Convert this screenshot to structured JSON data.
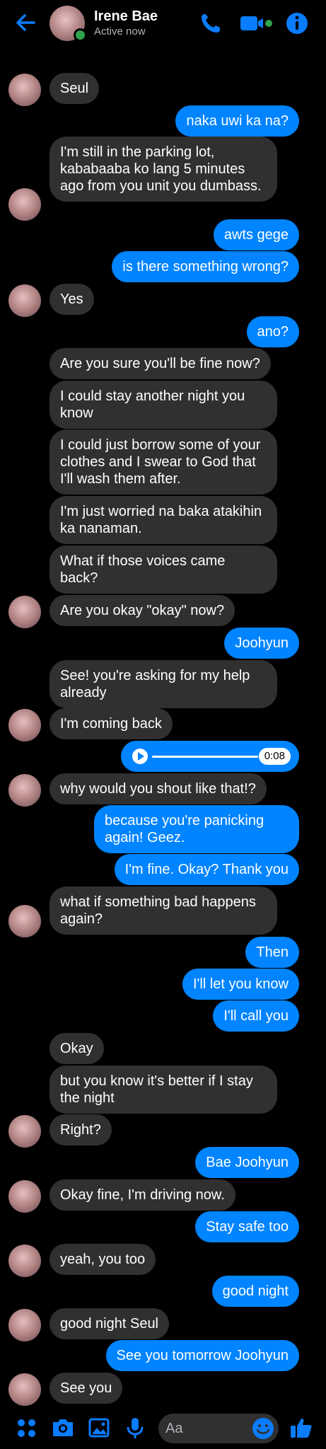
{
  "header": {
    "name": "Irene Bae",
    "status": "Active now"
  },
  "voice_message": {
    "duration": "0:08"
  },
  "messages": [
    {
      "side": "in",
      "text": "Seul"
    },
    {
      "side": "out",
      "text": "naka uwi ka na?"
    },
    {
      "side": "in",
      "text": "I'm still in the parking lot, kababaaba ko lang 5 minutes ago from you unit you dumbass."
    },
    {
      "side": "out",
      "text": "awts gege"
    },
    {
      "side": "out",
      "text": "is there something wrong?"
    },
    {
      "side": "in",
      "text": "Yes"
    },
    {
      "side": "out",
      "text": "ano?"
    },
    {
      "side": "in",
      "text": "Are you sure you'll be fine now?"
    },
    {
      "side": "in",
      "text": "I could stay another night you know"
    },
    {
      "side": "in",
      "text": "I could just borrow some of your clothes and I swear to God that I'll wash them after."
    },
    {
      "side": "in",
      "text": "I'm just worried na baka atakihin ka nanaman."
    },
    {
      "side": "in",
      "text": "What if those voices came back?"
    },
    {
      "side": "in",
      "text": "Are you okay \"okay\" now?"
    },
    {
      "side": "out",
      "text": "Joohyun"
    },
    {
      "side": "in",
      "text": "See! you're asking for my help already"
    },
    {
      "side": "in",
      "text": "I'm coming back"
    },
    {
      "side": "in",
      "text": "why would you shout like that!?"
    },
    {
      "side": "out",
      "text": "because you're panicking again! Geez."
    },
    {
      "side": "out",
      "text": "I'm fine. Okay? Thank you"
    },
    {
      "side": "in",
      "text": "what if something bad happens again?"
    },
    {
      "side": "out",
      "text": "Then"
    },
    {
      "side": "out",
      "text": "I'll let you know"
    },
    {
      "side": "out",
      "text": "I'll call you"
    },
    {
      "side": "in",
      "text": "Okay"
    },
    {
      "side": "in",
      "text": "but you know it's better if I stay the night"
    },
    {
      "side": "in",
      "text": "Right?"
    },
    {
      "side": "out",
      "text": "Bae Joohyun"
    },
    {
      "side": "in",
      "text": "Okay fine, I'm driving now."
    },
    {
      "side": "out",
      "text": "Stay safe too"
    },
    {
      "side": "in",
      "text": "yeah, you too"
    },
    {
      "side": "out",
      "text": "good night"
    },
    {
      "side": "in",
      "text": "good night Seul"
    },
    {
      "side": "out",
      "text": "See you tomorrow Joohyun"
    },
    {
      "side": "in",
      "text": "See you"
    }
  ],
  "composer": {
    "placeholder": "Aa"
  },
  "colors": {
    "accent": "#0084ff",
    "incoming_bubble": "#303030",
    "online": "#31a24c"
  },
  "icons": [
    "back-arrow-icon",
    "phone-icon",
    "video-icon",
    "info-icon",
    "apps-icon",
    "camera-icon",
    "gallery-icon",
    "mic-icon",
    "emoji-icon",
    "thumbs-up-icon"
  ]
}
